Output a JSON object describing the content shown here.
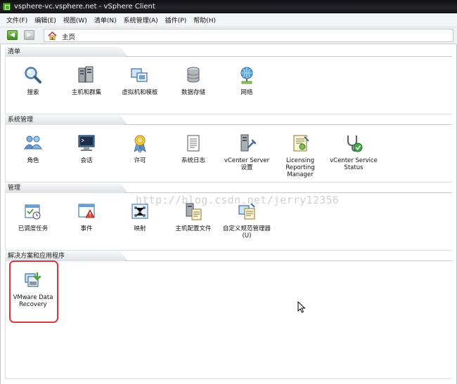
{
  "window": {
    "title": "vsphere-vc.vsphere.net - vSphere Client"
  },
  "menu": [
    "文件(F)",
    "编辑(E)",
    "视图(W)",
    "清单(N)",
    "系统管理(A)",
    "插件(P)",
    "帮助(H)"
  ],
  "nav": {
    "back_label": "◀",
    "forward_label": "▶",
    "address": "主页"
  },
  "sections": {
    "inventory": {
      "title": "清单",
      "items": [
        "搜索",
        "主机和群集",
        "虚拟机和模板",
        "数据存储",
        "网络"
      ]
    },
    "administration": {
      "title": "系统管理",
      "items": [
        "角色",
        "会话",
        "许可",
        "系统日志",
        "vCenter Server 设置",
        "Licensing Reporting Manager",
        "vCenter Service Status"
      ]
    },
    "management": {
      "title": "管理",
      "items": [
        "已调度任务",
        "事件",
        "映射",
        "主机配置文件",
        "自定义规范管理器(U)"
      ]
    },
    "solutions": {
      "title": "解决方案和应用程序",
      "items": [
        "VMware Data Recovery"
      ]
    }
  },
  "watermark": "http://blog.csdn.net/jerry12356",
  "colors": {
    "highlight": "#d9383b",
    "titlebar": "#1a1a1d"
  },
  "icons": [
    "search-icon",
    "hosts-clusters-icon",
    "vms-templates-icon",
    "datastores-icon",
    "network-icon",
    "roles-icon",
    "sessions-icon",
    "licensing-icon",
    "system-logs-icon",
    "vcenter-settings-icon",
    "licensing-reporting-icon",
    "service-status-icon",
    "scheduled-tasks-icon",
    "events-icon",
    "maps-icon",
    "host-profiles-icon",
    "customization-specs-icon",
    "data-recovery-icon"
  ]
}
